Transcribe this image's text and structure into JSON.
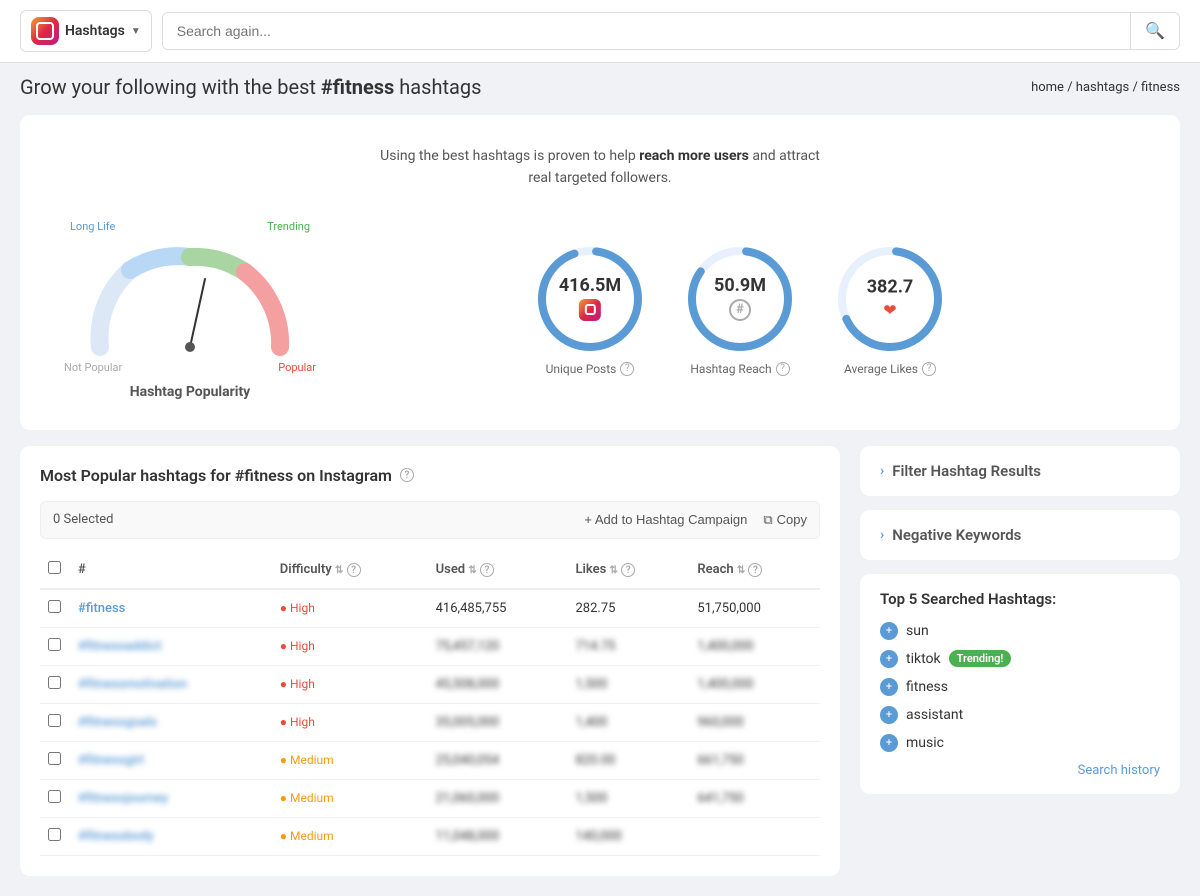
{
  "header": {
    "brand_label": "Hashtags",
    "search_placeholder": "Search again...",
    "search_btn_icon": "🔍"
  },
  "breadcrumb": {
    "home": "home",
    "separator": "/",
    "hashtags": "hashtags",
    "current": "fitness"
  },
  "page": {
    "title_prefix": "Grow your following with the best ",
    "title_hashtag": "#fitness",
    "title_suffix": " hashtags",
    "hero_text_1": "Using the best hashtags is proven to help ",
    "hero_bold": "reach more users",
    "hero_text_2": " and attract",
    "hero_text_3": "real targeted followers."
  },
  "gauge": {
    "label": "Hashtag Popularity",
    "legend_not_popular": "Not Popular",
    "legend_long_life": "Long Life",
    "legend_trending": "Trending",
    "legend_popular": "Popular"
  },
  "stats": [
    {
      "value": "416.5M",
      "label": "Unique Posts",
      "icon": "ig"
    },
    {
      "value": "50.9M",
      "label": "Hashtag Reach",
      "icon": "hash"
    },
    {
      "value": "382.7",
      "label": "Average Likes",
      "icon": "heart"
    }
  ],
  "table_section": {
    "title": "Most Popular hashtags for #fitness on Instagram",
    "selected_count": "0 Selected",
    "add_campaign_btn": "+ Add to Hashtag Campaign",
    "copy_btn": "Copy",
    "cols": [
      "#",
      "Difficulty",
      "Used",
      "Likes",
      "Reach"
    ],
    "rows": [
      {
        "name": "#fitness",
        "difficulty": "High",
        "used": "416,485,755",
        "likes": "282.75",
        "reach": "51,750,000",
        "diff_level": "high"
      },
      {
        "name": "#fitnessaddict",
        "difficulty": "High",
        "used": "75,457,120",
        "likes": "714.75",
        "reach": "1,400,000",
        "diff_level": "high"
      },
      {
        "name": "#fitnessmotivation",
        "difficulty": "High",
        "used": "45,508,000",
        "likes": "1,500",
        "reach": "1,400,000",
        "diff_level": "high"
      },
      {
        "name": "#fitnessgoals",
        "difficulty": "High",
        "used": "35,005,000",
        "likes": "1,400",
        "reach": "960,000",
        "diff_level": "high"
      },
      {
        "name": "#fitnessgirl",
        "difficulty": "Medium",
        "used": "25,040,054",
        "likes": "820.00",
        "reach": "661,750",
        "diff_level": "medium"
      },
      {
        "name": "#fitnessjourney",
        "difficulty": "Medium",
        "used": "21,060,000",
        "likes": "1,500",
        "reach": "641,750",
        "diff_level": "medium"
      },
      {
        "name": "#fitnessbody",
        "difficulty": "Medium",
        "used": "11,048,000",
        "likes": "140,000",
        "reach": "",
        "diff_level": "medium"
      }
    ]
  },
  "right_panel": {
    "filter_label": "Filter Hashtag Results",
    "negative_keywords_label": "Negative Keywords",
    "top_hashtags_title": "Top 5 Searched Hashtags:",
    "top_hashtags": [
      {
        "name": "sun",
        "trending": false
      },
      {
        "name": "tiktok",
        "trending": true
      },
      {
        "name": "fitness",
        "trending": false
      },
      {
        "name": "assistant",
        "trending": false
      },
      {
        "name": "music",
        "trending": false
      }
    ],
    "trending_badge": "Trending!",
    "search_history_link": "Search history"
  }
}
